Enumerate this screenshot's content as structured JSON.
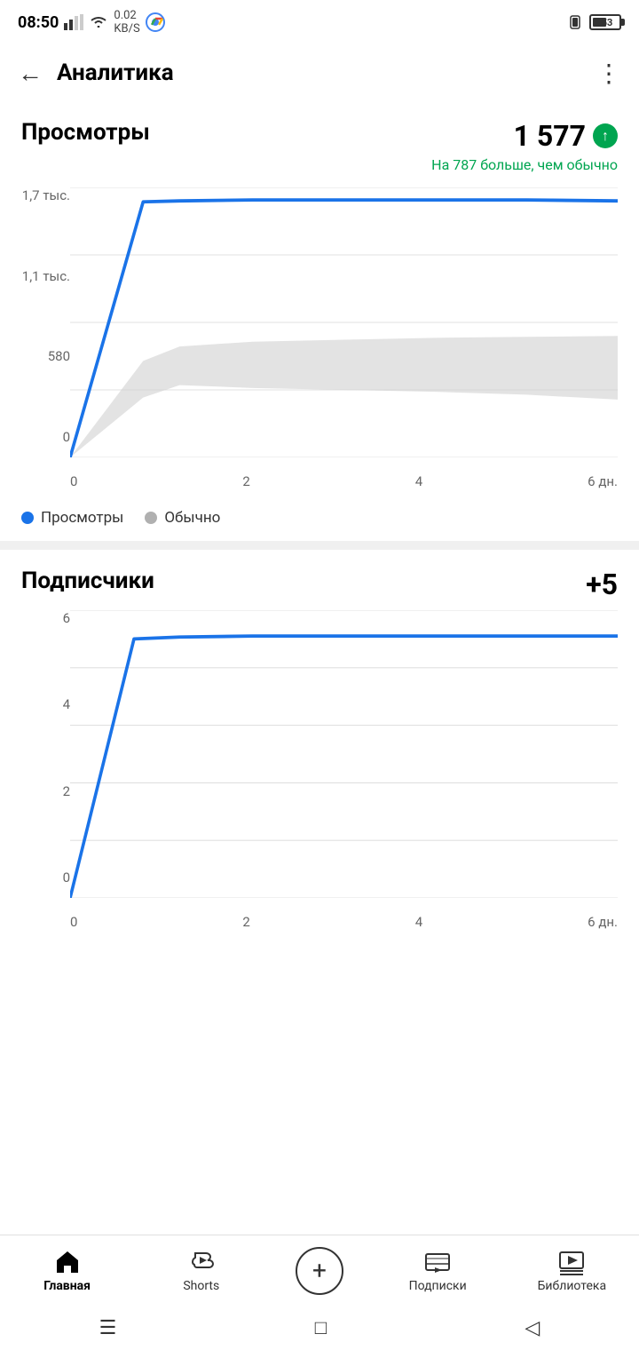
{
  "statusBar": {
    "time": "08:50",
    "signal": "▲▲",
    "wifi": "0.02\nKB/S",
    "battery": "53"
  },
  "header": {
    "back": "←",
    "title": "Аналитика",
    "more": "⋮"
  },
  "views": {
    "sectionTitle": "Просмотры",
    "value": "1 577",
    "subtitle": "На 787 больше, чем обычно",
    "yLabels": [
      "1,7 тыс.",
      "1,1 тыс.",
      "580",
      "0"
    ],
    "xLabels": [
      "0",
      "2",
      "4",
      "6 дн."
    ],
    "legend": {
      "views": "Просмотры",
      "normal": "Обычно"
    }
  },
  "subscribers": {
    "sectionTitle": "Подписчики",
    "value": "+5",
    "yLabels": [
      "6",
      "4",
      "2",
      "0"
    ],
    "xLabels": [
      "0",
      "2",
      "4",
      "6 дн."
    ]
  },
  "bottomNav": {
    "home": "Главная",
    "shorts": "Shorts",
    "add": "+",
    "subscriptions": "Подписки",
    "library": "Библиотека"
  }
}
